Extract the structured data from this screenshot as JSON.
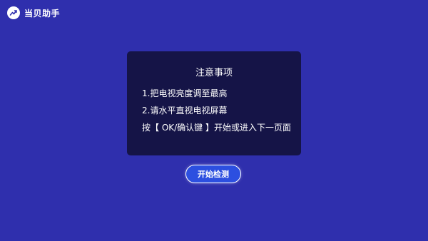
{
  "app": {
    "title": "当贝助手",
    "logo_icon": "trend-arrow-icon"
  },
  "notice": {
    "title": "注意事项",
    "lines": [
      "1.把电视亮度调至最高",
      "2.请水平直视电视屏幕",
      "按【 OK/确认键 】开始或进入下一页面"
    ]
  },
  "actions": {
    "start_label": "开始检测"
  },
  "colors": {
    "background": "#2f2fad",
    "card": "#151447",
    "button": "#2c4fe0",
    "text": "#ffffff"
  }
}
